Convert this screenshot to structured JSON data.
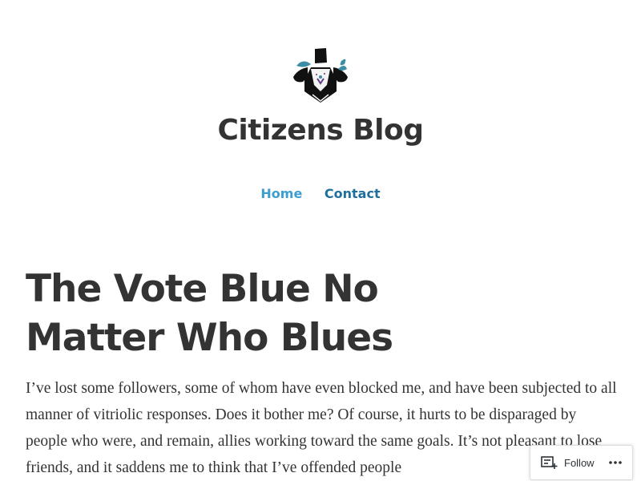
{
  "site": {
    "title": "Citizens Blog"
  },
  "nav": {
    "items": [
      "Home",
      "Contact"
    ]
  },
  "post": {
    "title": "The Vote Blue No Matter Who Blues",
    "body": "I’ve lost some followers, some of whom have even blocked me, and have been subjected to all manner of vitriolic responses. Does it bother me? Of course, it hurts to be disparaged by people who were, and remain, allies working toward the same goals. It’s not pleasant to lose friends, and it saddens me to think that I’ve offended people"
  },
  "follow_bar": {
    "follow_label": "Follow",
    "icons": [
      "reader-follow-icon",
      "more-options-icon"
    ]
  },
  "colors": {
    "text": "#333333",
    "nav_home": "#3c9ecf",
    "nav_contact": "#1f6f9e",
    "logo_accent": "#3b8ea5"
  }
}
